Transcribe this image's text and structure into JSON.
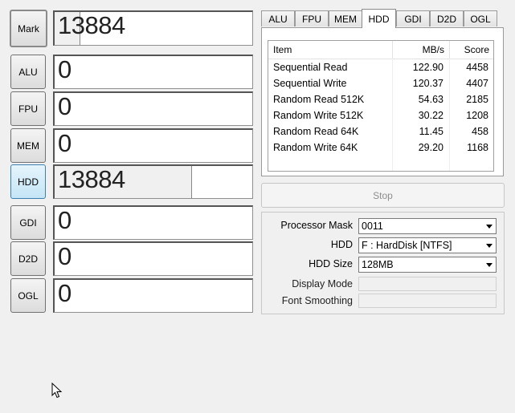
{
  "left_buttons": {
    "mark": "Mark",
    "alu": "ALU",
    "fpu": "FPU",
    "mem": "MEM",
    "hdd": "HDD",
    "gdi": "GDI",
    "d2d": "D2D",
    "ogl": "OGL"
  },
  "scores": {
    "mark": "13884",
    "alu": "0",
    "fpu": "0",
    "mem": "0",
    "hdd": "13884",
    "gdi": "0",
    "d2d": "0",
    "ogl": "0"
  },
  "tabs": [
    "ALU",
    "FPU",
    "MEM",
    "HDD",
    "GDI",
    "D2D",
    "OGL"
  ],
  "selected_tab": "HDD",
  "results": {
    "headers": [
      "Item",
      "MB/s",
      "Score"
    ],
    "rows": [
      {
        "item": "Sequential Read",
        "mbs": "122.90",
        "score": "4458"
      },
      {
        "item": "Sequential Write",
        "mbs": "120.37",
        "score": "4407"
      },
      {
        "item": "Random Read 512K",
        "mbs": "54.63",
        "score": "2185"
      },
      {
        "item": "Random Write 512K",
        "mbs": "30.22",
        "score": "1208"
      },
      {
        "item": "Random Read 64K",
        "mbs": "11.45",
        "score": "458"
      },
      {
        "item": "Random Write 64K",
        "mbs": "29.20",
        "score": "1168"
      }
    ]
  },
  "stop_label": "Stop",
  "options": {
    "processor_mask_label": "Processor Mask",
    "processor_mask_value": "0011",
    "hdd_label": "HDD",
    "hdd_value": "F : HardDisk [NTFS]",
    "hdd_size_label": "HDD Size",
    "hdd_size_value": "128MB",
    "display_mode_label": "Display Mode",
    "font_smoothing_label": "Font Smoothing"
  }
}
